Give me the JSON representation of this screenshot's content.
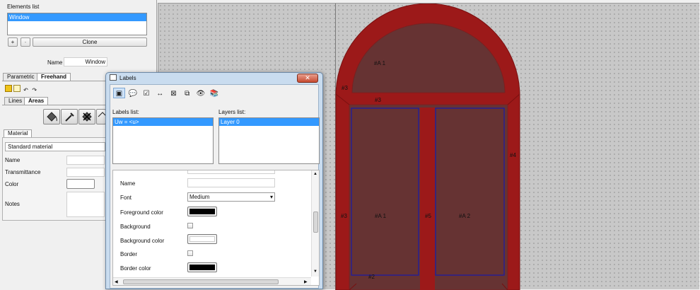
{
  "left_panel": {
    "elements_title": "Elements list",
    "elements": [
      "Window"
    ],
    "add_label": "+",
    "remove_label": "-",
    "clone_label": "Clone",
    "name_label": "Name",
    "name_value": "Window",
    "tabs": [
      "Parametric",
      "Freehand"
    ],
    "subtabs": [
      "Lines",
      "Areas"
    ],
    "material_tab": "Material",
    "material_select": "Standard material",
    "fields": {
      "name": "Name",
      "transmittance": "Transmittance",
      "color": "Color",
      "notes": "Notes"
    }
  },
  "canvas": {
    "labels": {
      "a1_top": "#A 1",
      "n3_left_top": "#3",
      "n3_center": "#3",
      "n4": "#4",
      "n3_left": "#3",
      "a1_mid": "#A 1",
      "n5": "#5",
      "a2": "#A 2",
      "n2": "#2"
    },
    "colors": {
      "frame": "#9c1919",
      "glass": "#663333",
      "pane_border": "#1a1aa8"
    }
  },
  "labels_dialog": {
    "title": "Labels",
    "close_label": "✕",
    "labels_list_title": "Labels list:",
    "labels_list": [
      "Uw = <u>"
    ],
    "layers_list_title": "Layers list:",
    "layers_list": [
      "Layer 0"
    ],
    "properties": {
      "name_label": "Name",
      "name_value": "",
      "font_label": "Font",
      "font_value": "Medium",
      "fg_color_label": "Foreground color",
      "fg_color": "#000000",
      "background_label": "Background",
      "bg_color_label": "Background color",
      "bg_color": "#ffffff",
      "border_label": "Border",
      "border_color_label": "Border color",
      "border_color": "#000000"
    }
  }
}
